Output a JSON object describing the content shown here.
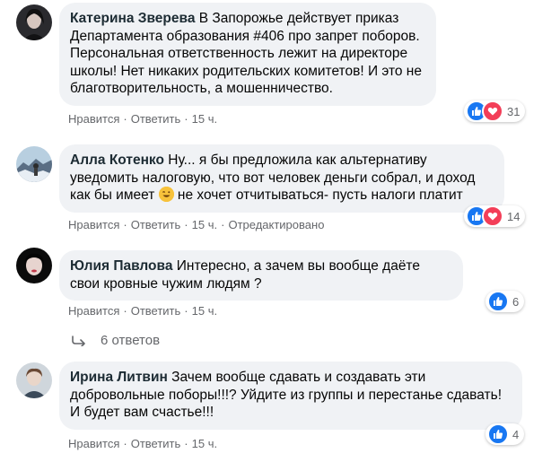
{
  "comments": [
    {
      "author": "Катерина Зверева",
      "text": "В Запорожье действует приказ Департамента образования #406 про запрет поборов. Персональная ответственность лежит на директоре школы! Нет никаких родительских комитетов! И это не благотворительность, а мошенничество.",
      "like_label": "Нравится",
      "reply_label": "Ответить",
      "time": "15 ч.",
      "reaction_count": "31"
    },
    {
      "author": "Алла Котенко",
      "text_before": "Ну... я бы предложила как альтернативу уведомить налоговую, что вот человек деньги собрал, и доход как бы имеет",
      "text_after": "не хочет отчитываться- пусть налоги платит",
      "like_label": "Нравится",
      "reply_label": "Ответить",
      "time": "15 ч.",
      "edited_label": "Отредактировано",
      "reaction_count": "14"
    },
    {
      "author": "Юлия Павлова",
      "text": "Интересно, а зачем вы вообще даёте свои кровные чужим людям ?",
      "like_label": "Нравится",
      "reply_label": "Ответить",
      "time": "15 ч.",
      "reaction_count": "6",
      "replies_label": "6 ответов"
    },
    {
      "author": "Ирина Литвин",
      "text": "Зачем вообще сдавать и создавать эти добровольные поборы!!!? Уйдите из группы и перестанье сдавать! И будет вам счастье!!!",
      "like_label": "Нравится",
      "reply_label": "Ответить",
      "time": "15 ч.",
      "reaction_count": "4"
    }
  ],
  "colors": {
    "bubble": "#f0f2f5",
    "like": "#1877f2",
    "love": "#f33e58",
    "meta": "#65676b"
  },
  "icons": [
    "like-reaction-icon",
    "love-reaction-icon",
    "reply-arrow-icon",
    "grinning-emoji-icon"
  ]
}
